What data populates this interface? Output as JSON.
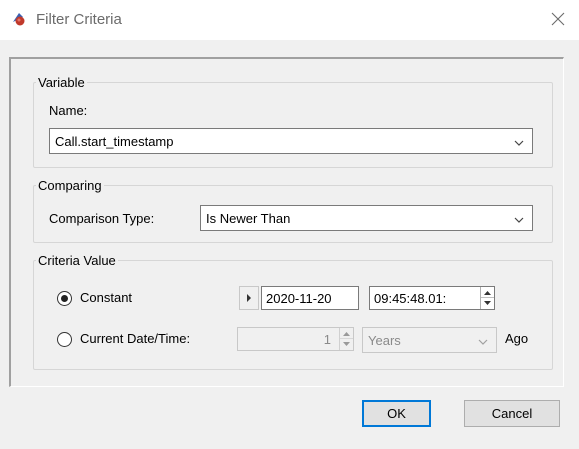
{
  "window": {
    "title": "Filter Criteria",
    "icon": "app-icon",
    "close_icon": "close-icon"
  },
  "variable": {
    "group_label": "Variable",
    "name_label": "Name:",
    "name_value": "Call.start_timestamp"
  },
  "comparing": {
    "group_label": "Comparing",
    "type_label": "Comparison Type:",
    "type_value": "Is Newer Than"
  },
  "criteria": {
    "group_label": "Criteria Value",
    "constant_label": "Constant",
    "constant_selected": true,
    "current_label": "Current Date/Time:",
    "current_selected": false,
    "date_value": "2020-11-20",
    "time_value": "09:45:48.01:",
    "amount_value": "1",
    "unit_value": "Years",
    "ago_label": "Ago"
  },
  "buttons": {
    "ok_label": "OK",
    "cancel_label": "Cancel"
  },
  "colors": {
    "default_button_border": "#0078d7",
    "background": "#f0f0f0"
  }
}
